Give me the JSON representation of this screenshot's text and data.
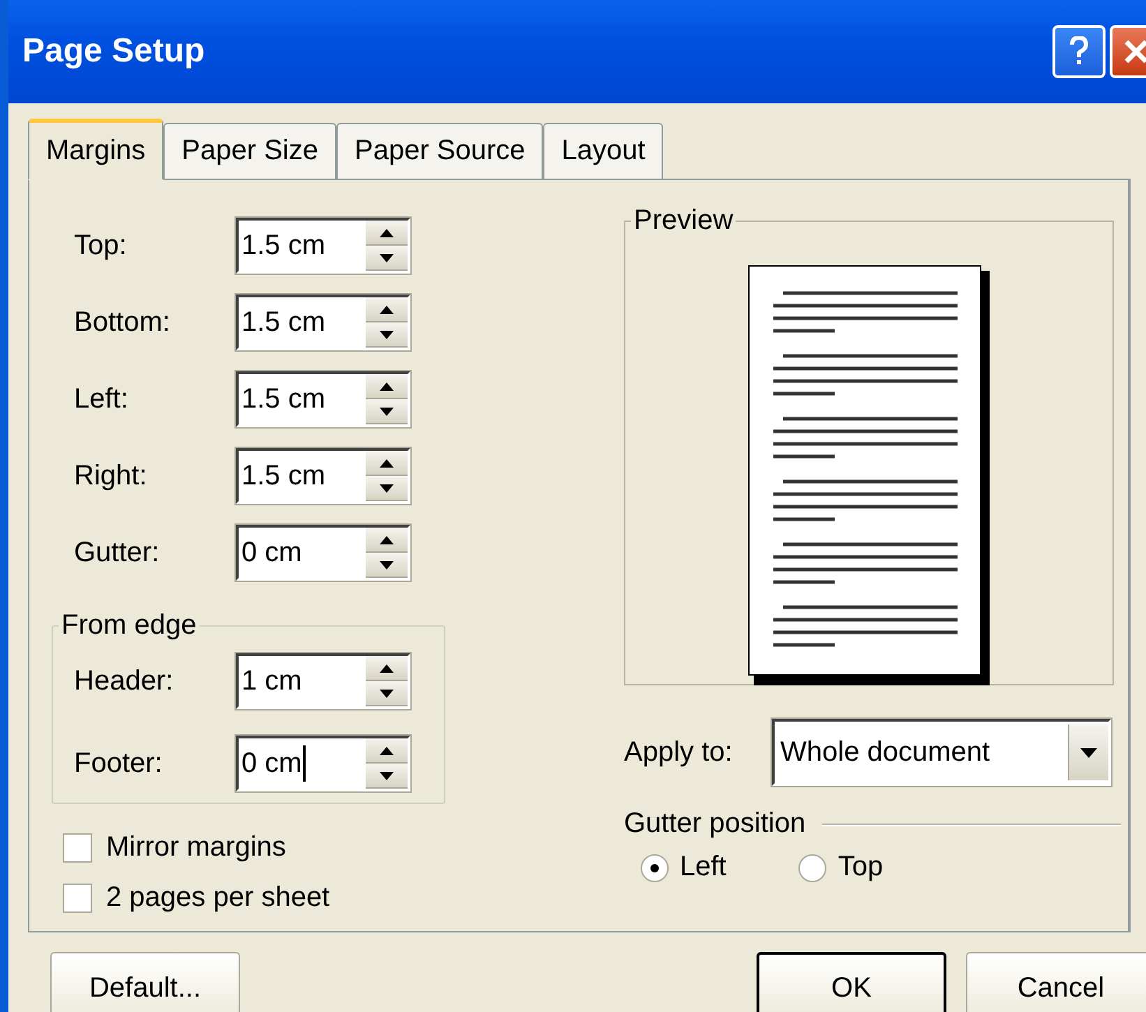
{
  "window": {
    "title": "Page Setup"
  },
  "tabs": [
    {
      "label": "Margins",
      "selected": true
    },
    {
      "label": "Paper Size",
      "selected": false
    },
    {
      "label": "Paper Source",
      "selected": false
    },
    {
      "label": "Layout",
      "selected": false
    }
  ],
  "margins": [
    {
      "label": "Top:",
      "value": "1.5 cm",
      "focused": false
    },
    {
      "label": "Bottom:",
      "value": "1.5 cm",
      "focused": false
    },
    {
      "label": "Left:",
      "value": "1.5 cm",
      "focused": false
    },
    {
      "label": "Right:",
      "value": "1.5 cm",
      "focused": false
    },
    {
      "label": "Gutter:",
      "value": "0 cm",
      "focused": false
    }
  ],
  "from_edge": {
    "title": "From edge",
    "fields": [
      {
        "label": "Header:",
        "value": "1 cm",
        "focused": false
      },
      {
        "label": "Footer:",
        "value": "0 cm",
        "focused": true
      }
    ]
  },
  "options": [
    {
      "label": "Mirror margins",
      "checked": false
    },
    {
      "label": "2 pages per sheet",
      "checked": false
    }
  ],
  "preview": {
    "title": "Preview"
  },
  "apply_to": {
    "label": "Apply to:",
    "value": "Whole document"
  },
  "gutter_position": {
    "title": "Gutter position",
    "options": [
      {
        "label": "Left",
        "selected": true
      },
      {
        "label": "Top",
        "selected": false
      }
    ]
  },
  "buttons": [
    {
      "label": "Default...",
      "default": false
    },
    {
      "label": "OK",
      "default": true
    },
    {
      "label": "Cancel",
      "default": false
    }
  ]
}
